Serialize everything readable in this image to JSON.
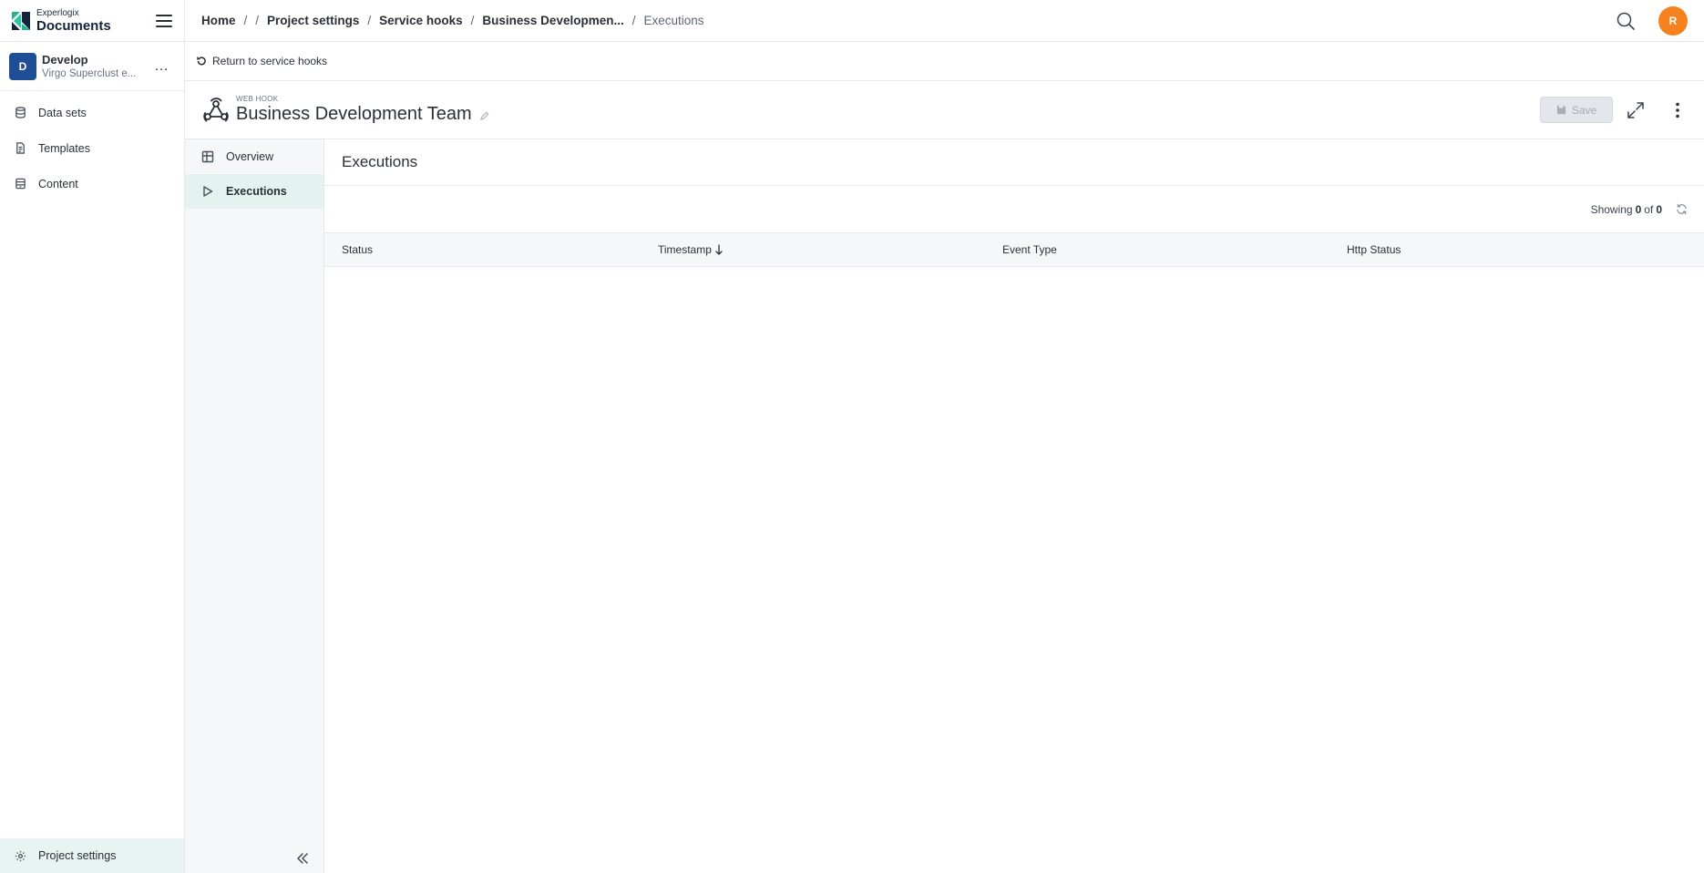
{
  "brand": {
    "small": "Experlogix",
    "big": "Documents"
  },
  "project": {
    "initial": "D",
    "name": "Develop",
    "subtitle": "Virgo Superclust e...",
    "more": "…"
  },
  "sidebar": {
    "items": [
      {
        "label": "Data sets",
        "icon": "database-icon"
      },
      {
        "label": "Templates",
        "icon": "template-icon"
      },
      {
        "label": "Content",
        "icon": "content-icon"
      }
    ],
    "bottom": {
      "label": "Project settings",
      "icon": "gear-icon"
    }
  },
  "breadcrumb": {
    "home": "Home",
    "sep": "/",
    "items": [
      "Project settings",
      "Service hooks",
      "Business Developmen..."
    ],
    "current": "Executions"
  },
  "user": {
    "initial": "R",
    "color": "#f6821f"
  },
  "return": {
    "label": "Return to service hooks"
  },
  "entity": {
    "kind": "WEB HOOK",
    "title": "Business Development Team",
    "save_label": "Save"
  },
  "subnav": {
    "items": [
      {
        "label": "Overview",
        "icon": "grid-icon",
        "active": false
      },
      {
        "label": "Executions",
        "icon": "play-icon",
        "active": true
      }
    ]
  },
  "main": {
    "title": "Executions",
    "showing_prefix": "Showing",
    "showing_count": "0",
    "showing_of": "of",
    "showing_total": "0",
    "columns": {
      "status": "Status",
      "timestamp": "Timestamp",
      "event_type": "Event Type",
      "http_status": "Http Status"
    },
    "rows": []
  },
  "colors": {
    "accent_bg": "#e4f3f0",
    "project_avatar": "#1f4e96",
    "brand_teal": "#1fb58f",
    "brand_navy": "#14233a"
  }
}
